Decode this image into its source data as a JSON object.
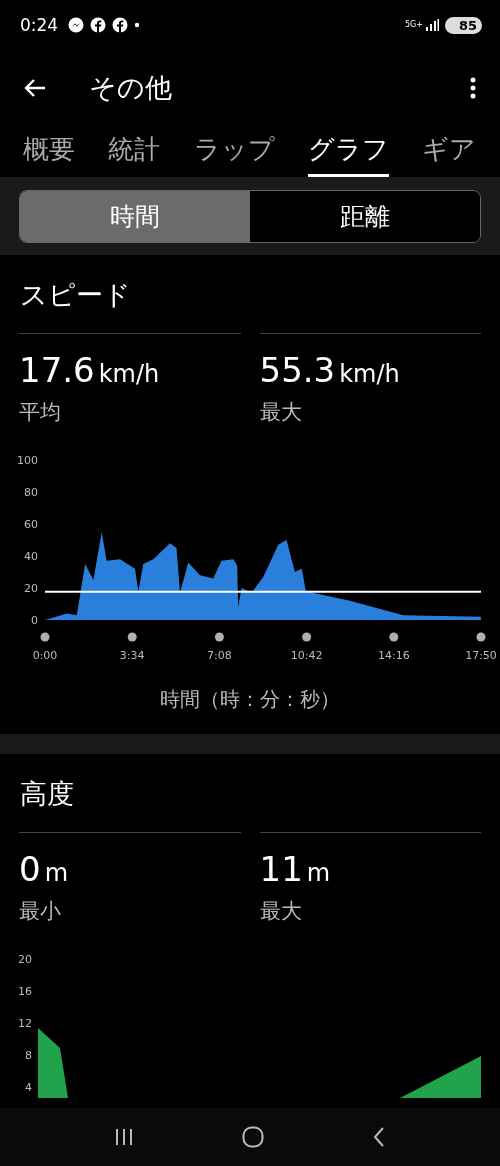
{
  "status_bar": {
    "time": "0:24",
    "network": "5G+",
    "battery": "85"
  },
  "app_bar": {
    "title": "その他"
  },
  "tabs": [
    {
      "label": "概要",
      "selected": false
    },
    {
      "label": "統計",
      "selected": false
    },
    {
      "label": "ラップ",
      "selected": false
    },
    {
      "label": "グラフ",
      "selected": true
    },
    {
      "label": "ギア",
      "selected": false
    }
  ],
  "segments": [
    {
      "label": "時間",
      "selected": true
    },
    {
      "label": "距離",
      "selected": false
    }
  ],
  "sections": [
    {
      "title": "スピード",
      "stats": [
        {
          "value": "17.6",
          "unit": "km/h",
          "label": "平均"
        },
        {
          "value": "55.3",
          "unit": "km/h",
          "label": "最大"
        }
      ],
      "chart_data": {
        "type": "area",
        "xlabel": "時間（時：分：秒）",
        "ylim": [
          0,
          100
        ],
        "yticks": [
          0,
          20,
          40,
          60,
          80,
          100
        ],
        "xlim": [
          0,
          17.833
        ],
        "xticks": [
          {
            "value": 0,
            "label": "0:00"
          },
          {
            "value": 3.567,
            "label": "3:34"
          },
          {
            "value": 7.133,
            "label": "7:08"
          },
          {
            "value": 10.7,
            "label": "10:42"
          },
          {
            "value": 14.267,
            "label": "14:16"
          },
          {
            "value": 17.833,
            "label": "17:50"
          }
        ],
        "x": [
          0,
          0.9,
          1.3,
          1.64,
          1.98,
          2.32,
          2.52,
          3.07,
          3.68,
          3.82,
          4.02,
          4.43,
          5.11,
          5.38,
          5.52,
          5.86,
          6.34,
          6.88,
          7.22,
          7.7,
          7.86,
          7.9,
          8.04,
          8.45,
          8.93,
          9.54,
          9.88,
          10.22,
          10.5,
          10.67,
          12.47,
          14.65,
          17.83
        ],
        "series": [
          {
            "color": "#2a7fdc",
            "values": [
              0,
              4,
              3,
              35,
              25,
              55,
              37,
              38,
              32,
              18,
              35,
              38,
              48,
              45,
              17,
              36,
              28,
              26,
              37,
              38,
              34,
              8,
              20,
              17,
              27,
              47,
              50,
              30,
              32,
              18,
              12,
              3,
              2
            ]
          }
        ],
        "ref_lines": [
          {
            "axis": "y",
            "value": 17.6
          }
        ]
      }
    },
    {
      "title": "高度",
      "stats": [
        {
          "value": "0",
          "unit": "m",
          "label": "最小"
        },
        {
          "value": "11",
          "unit": "m",
          "label": "最大"
        }
      ],
      "graph": {
        "y_labels": [
          "20",
          "16",
          "12",
          "8",
          "4"
        ]
      }
    }
  ]
}
